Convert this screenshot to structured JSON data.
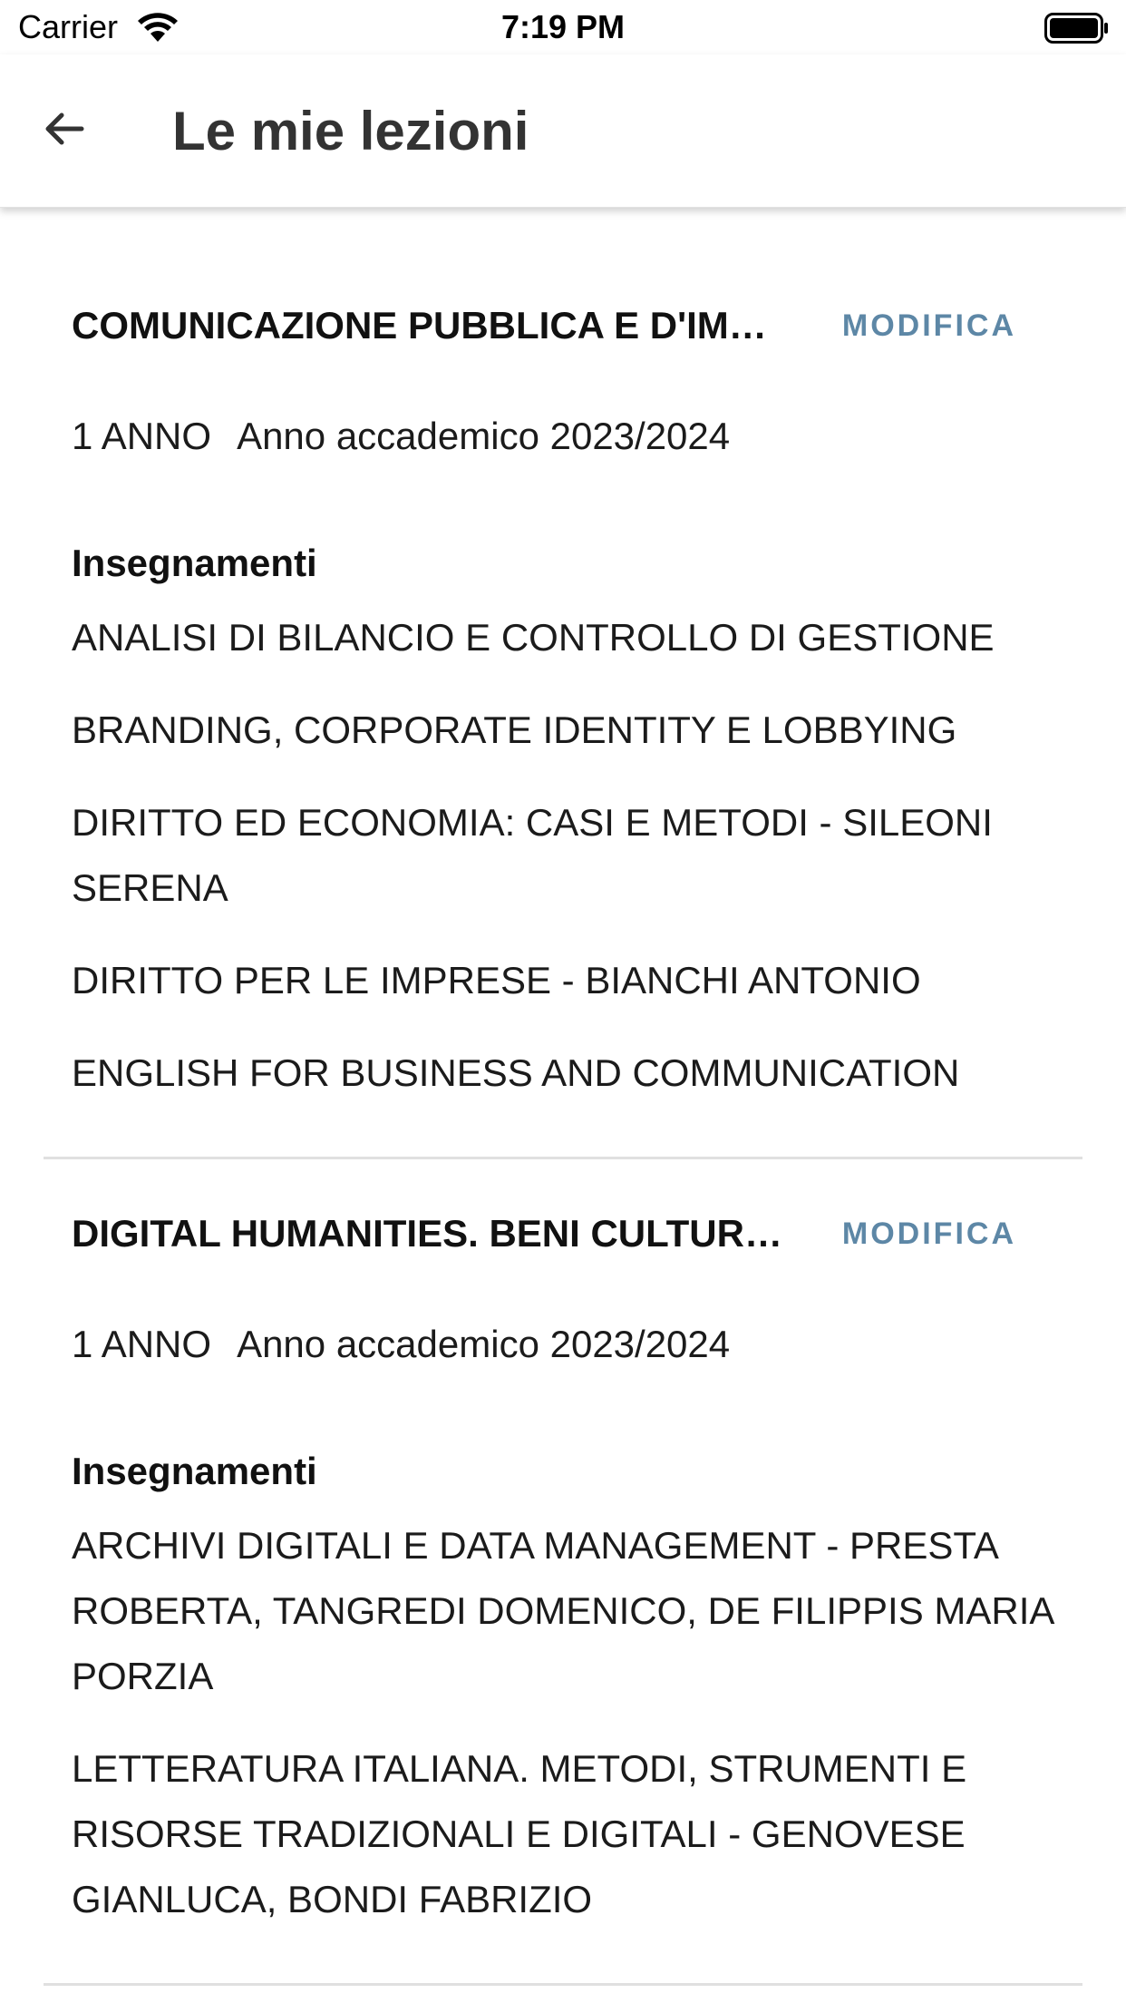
{
  "status_bar": {
    "carrier": "Carrier",
    "time": "7:19 PM",
    "wifi_icon": "wifi-icon",
    "battery_icon": "battery-icon"
  },
  "header": {
    "title": "Le mie lezioni",
    "back_icon": "back-arrow-icon"
  },
  "courses": [
    {
      "name": "COMUNICAZIONE PUBBLICA E D'IMPRESA",
      "edit_label": "MODIFICA",
      "year": "1 ANNO",
      "academic_year": "Anno accademico 2023/2024",
      "section_label": "Insegnamenti",
      "subjects": [
        "ANALISI DI BILANCIO E CONTROLLO DI GESTIONE",
        "BRANDING, CORPORATE IDENTITY E LOBBYING",
        "DIRITTO ED ECONOMIA: CASI E METODI - SILEONI SERENA",
        "DIRITTO PER LE IMPRESE - BIANCHI ANTONIO",
        "ENGLISH FOR BUSINESS AND COMMUNICATION"
      ]
    },
    {
      "name": "DIGITAL HUMANITIES. BENI CULTURALI",
      "edit_label": "MODIFICA",
      "year": "1 ANNO",
      "academic_year": "Anno accademico 2023/2024",
      "section_label": "Insegnamenti",
      "subjects": [
        "ARCHIVI DIGITALI E DATA MANAGEMENT - PRESTA ROBERTA, TANGREDI DOMENICO, DE FILIPPIS MARIA PORZIA",
        "LETTERATURA ITALIANA. METODI, STRUMENTI E RISORSE TRADIZIONALI E DIGITALI - GENOVESE GIANLUCA, BONDI FABRIZIO"
      ]
    }
  ],
  "colors": {
    "accent": "#5d87a6",
    "text": "#1b1b1b",
    "title": "#333333",
    "divider": "#e0e0e0"
  }
}
